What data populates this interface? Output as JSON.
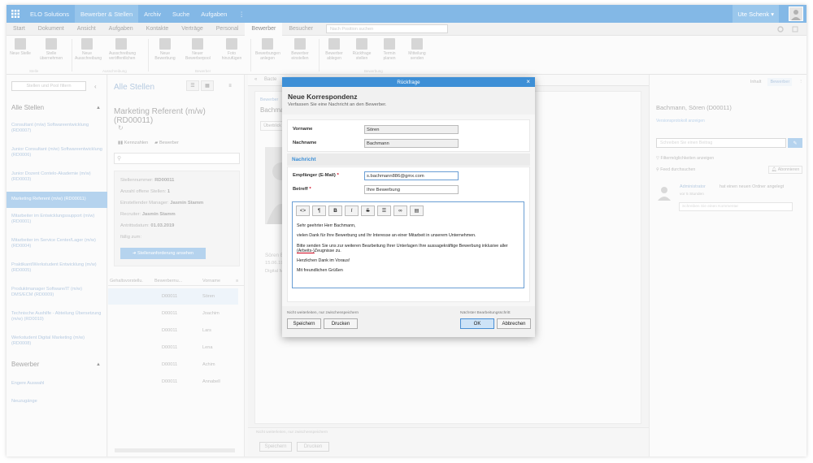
{
  "topbar": {
    "nav": [
      "ELO Solutions",
      "Bewerber & Stellen",
      "Archiv",
      "Suche",
      "Aufgaben"
    ],
    "user": "Ute Schenk"
  },
  "ribbon_tabs": {
    "tabs": [
      "Start",
      "Dokument",
      "Ansicht",
      "Aufgaben",
      "Kontakte",
      "Verträge",
      "Personal",
      "Bewerber",
      "Besucher"
    ],
    "active": "Bewerber",
    "position_search_placeholder": "Nach Position suchen"
  },
  "ribbon": {
    "buttons": [
      {
        "label": "Neue Stelle",
        "icon": "new-position-icon"
      },
      {
        "label": "Stelle übernehmen",
        "icon": "take-position-icon"
      },
      {
        "label": "Neue Ausschreibung",
        "icon": "new-posting-icon"
      },
      {
        "label": "Ausschreibung veröffentlichen",
        "icon": "publish-icon"
      },
      {
        "label": "Neue Bewerbung",
        "icon": "new-application-icon"
      },
      {
        "label": "Neuer Bewerberpool",
        "icon": "pool-icon"
      },
      {
        "label": "Foto hinzufügen",
        "icon": "photo-icon"
      },
      {
        "label": "Bewerbungen anlegen",
        "icon": "create-applications-icon"
      },
      {
        "label": "Bewerber einstellen",
        "icon": "hire-icon"
      },
      {
        "label": "Bewerber ablegen",
        "icon": "file-applicant-icon"
      },
      {
        "label": "Rückfrage stellen",
        "icon": "inquiry-icon"
      },
      {
        "label": "Termin planen",
        "icon": "schedule-icon"
      },
      {
        "label": "Mitteilung senden",
        "icon": "message-icon"
      }
    ],
    "groups": [
      "Stelle",
      "Ausschreibung",
      "Bewerber",
      "Bewerbung"
    ]
  },
  "sidebar": {
    "search_placeholder": "Stellen und Pool filtern",
    "section_stellen": "Alle Stellen",
    "items": [
      "Consultant (m/w) Softwareentwicklung (RD0007)",
      "Junior Consultant (m/w) Softwareentwicklung (RD0006)",
      "Junior Dozent Contelo-Akademie (m/w) (RD0003)",
      "Marketing Referent (m/w) (RD00011)",
      "Mitarbeiter im Entwicklungssupport (m/w) (RD0001)",
      "Mitarbeiter im Service Center/Lager (m/w) (RD0004)",
      "Praktikant/Werkstudent Entwicklung (m/w) (RD0005)",
      "Produktmanager Software/IT (m/w) DMS/ECM (RD0009)",
      "Technische Aushilfe - Abteilung Übersetzung (m/w) (RD0010)",
      "Werkstudent Digital Marketing (m/w) (RD0008)"
    ],
    "active_index": 3,
    "section_bewerber": "Bewerber",
    "bewerber_items": [
      "Engere Auswahl",
      "Neuzugänge"
    ]
  },
  "midpanel": {
    "title": "Alle Stellen",
    "detail_title": "Marketing Referent (m/w) (RD00011)",
    "tab_kennzahlen": "Kennzahlen",
    "tab_bewerber": "Bewerber",
    "stellennummer_label": "Stellennummer:",
    "stellennummer": "RD00011",
    "offene_stellen_label": "Anzahl offene Stellen:",
    "offene_stellen": "1",
    "manager_label": "Einstellender Manager:",
    "manager": "Jasmin Stamm",
    "recruiter_label": "Recruiter:",
    "recruiter": "Jasmin Stamm",
    "antritt_label": "Antrittsdatum:",
    "antritt": "01.03.2019",
    "faellig_label": "fällig zum:",
    "button": "Stellenanforderung ansehen",
    "columns": [
      "Gehaltsvorstellu.",
      "Bewerbernu...",
      "Vorname"
    ],
    "rows": [
      {
        "nr": "D00011",
        "vorname": "Sören"
      },
      {
        "nr": "D00011",
        "vorname": "Joachim"
      },
      {
        "nr": "D00011",
        "vorname": "Lars"
      },
      {
        "nr": "D00011",
        "vorname": "Lena"
      },
      {
        "nr": "D00011",
        "vorname": "Achim"
      },
      {
        "nr": "D00011",
        "vorname": "Annabell"
      }
    ]
  },
  "content": {
    "breadcrumb": "Bacte",
    "section_label": "Bewerber",
    "name_short": "Bachman",
    "tab": "Überblick",
    "person_name": "Sören Ba",
    "person_date": "15.06.199",
    "person_role": "Digital Mar",
    "footer_hint": "Nicht weiterleiten, nur zwischenspeichern",
    "save": "Speichern",
    "print": "Drucken"
  },
  "rightpanel": {
    "tab_inhalt": "Inhalt",
    "tab_bewerber": "Bewerber",
    "title": "Bachmann, Sören (D00011)",
    "link": "Versionsprotokoll anzeigen",
    "input_placeholder": "Schreiben Sie einen Beitrag",
    "filter": "Filtermöglichkeiten anzeigen",
    "feed": "Feed durchsuchen",
    "abonnieren": "Abonnieren",
    "feed_author": "Administrator",
    "feed_text": "hat einen neuen Ordner angelegt",
    "feed_time": "vor 5 Stunden",
    "feed_comment": "Schreiben Sie einen Kommentar"
  },
  "dialog": {
    "title": "Rückfrage",
    "heading": "Neue Korrespondenz",
    "subheading": "Verfassen Sie eine Nachricht an den Bewerber.",
    "vorname_label": "Vorname",
    "vorname": "Sören",
    "nachname_label": "Nachname",
    "nachname": "Bachmann",
    "section": "Nachricht",
    "empfaenger_label": "Empfänger (E-Mail)",
    "empfaenger": "s.bachmann886@gmx.com",
    "betreff_label": "Betreff",
    "betreff": "Ihre Bewerbung",
    "body": {
      "p1": "Sehr geehrter Herr Bachmann,",
      "p2": "vielen Dank für Ihre Bewerbung und Ihr Interesse an einer Mitarbeit in unserem Unternehmen.",
      "p3a": "Bitte senden Sie uns zur weiteren Bearbeitung Ihrer Unterlagen Ihre aussagekräftige Bewerbung inklusive aller ",
      "p3u": "(Arbeits-)",
      "p3b": "Zeugnisse zu.",
      "p4": "Herzlichen Dank im Voraus!",
      "p5": "Mit freundlichen Grüßen"
    },
    "footer_left": "Nicht weiterleiten, nur zwischenspeichern",
    "footer_right": "Nächster Bearbeitungsschritt",
    "save": "Speichern",
    "print": "Drucken",
    "ok": "OK",
    "cancel": "Abbrechen"
  },
  "colors": {
    "accent": "#3d8fd6",
    "topbar": "#5aa0de",
    "required": "#d0021b"
  }
}
